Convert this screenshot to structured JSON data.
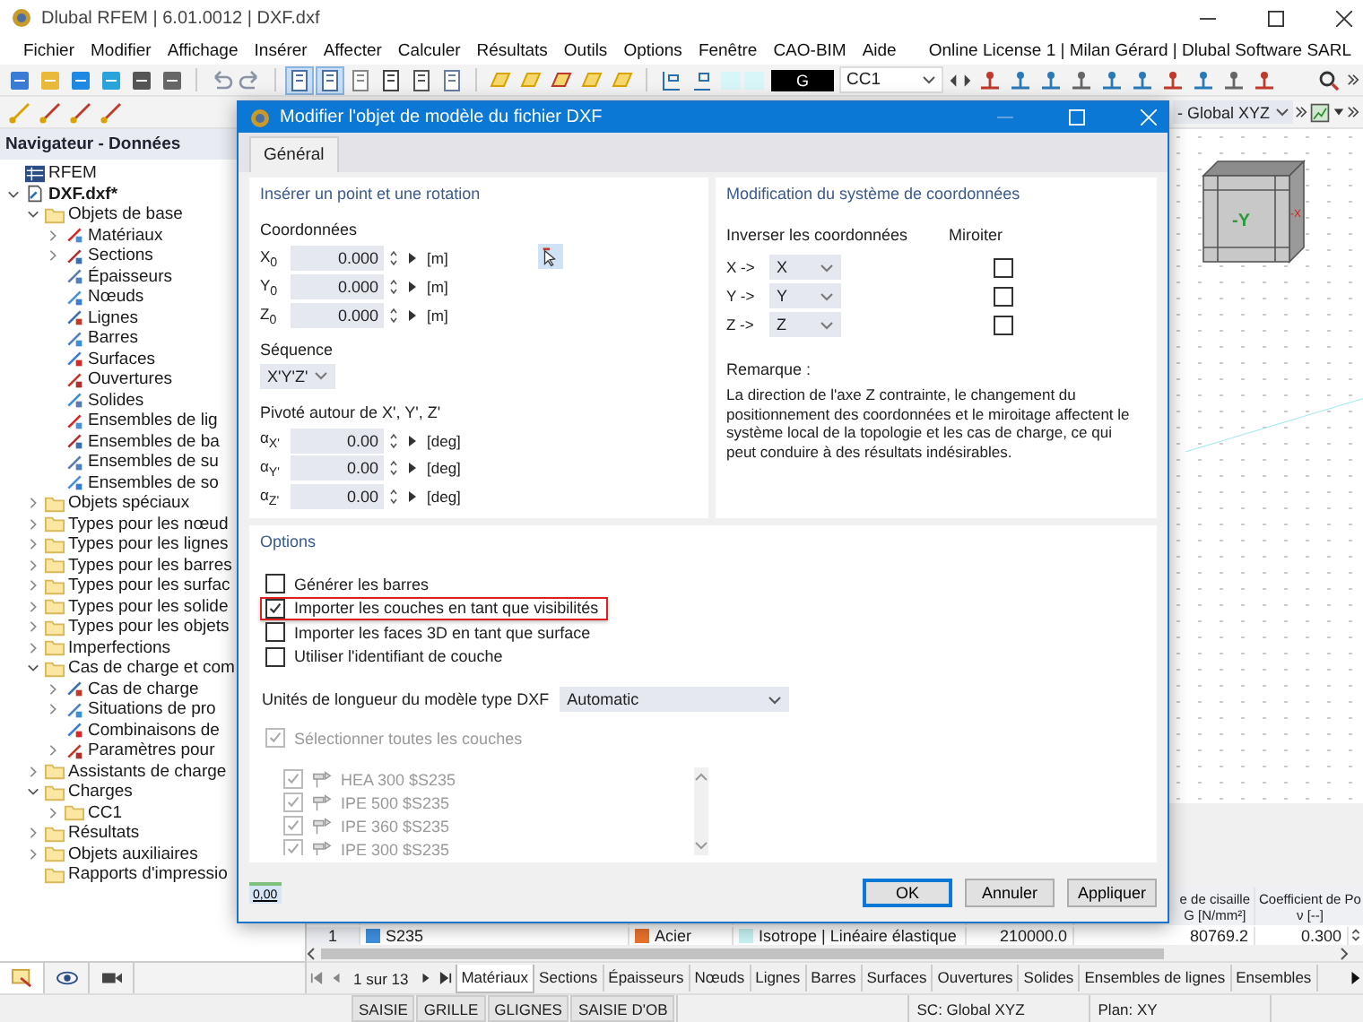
{
  "window": {
    "title": "Dlubal RFEM | 6.01.0012 | DXF.dxf"
  },
  "menu": [
    "Fichier",
    "Modifier",
    "Affichage",
    "Insérer",
    "Affecter",
    "Calculer",
    "Résultats",
    "Outils",
    "Options",
    "Fenêtre",
    "CAO-BIM",
    "Aide"
  ],
  "license": "Online License 1 | Milan Gérard | Dlubal Software SARL",
  "toolbar": {
    "color_label": "G",
    "load_case": "CC1",
    "coord_system": "- Global XYZ"
  },
  "navigator": {
    "title": "Navigateur - Données",
    "tree": [
      {
        "label": "RFEM",
        "kind": "root"
      },
      {
        "label": "DXF.dxf*",
        "kind": "file",
        "expanded": true,
        "children": [
          {
            "label": "Objets de base",
            "kind": "folder",
            "expanded": true,
            "children": [
              {
                "label": "Matériaux",
                "kind": "object",
                "expanded": false
              },
              {
                "label": "Sections",
                "kind": "object",
                "expanded": false
              },
              {
                "label": "Épaisseurs",
                "kind": "object"
              },
              {
                "label": "Nœuds",
                "kind": "object"
              },
              {
                "label": "Lignes",
                "kind": "object"
              },
              {
                "label": "Barres",
                "kind": "object"
              },
              {
                "label": "Surfaces",
                "kind": "object"
              },
              {
                "label": "Ouvertures",
                "kind": "object"
              },
              {
                "label": "Solides",
                "kind": "object"
              },
              {
                "label": "Ensembles de lig",
                "kind": "object"
              },
              {
                "label": "Ensembles de ba",
                "kind": "object"
              },
              {
                "label": "Ensembles de su",
                "kind": "object"
              },
              {
                "label": "Ensembles de so",
                "kind": "object"
              }
            ]
          },
          {
            "label": "Objets spéciaux",
            "kind": "folder",
            "expanded": false
          },
          {
            "label": "Types pour les nœud",
            "kind": "folder",
            "expanded": false
          },
          {
            "label": "Types pour les lignes",
            "kind": "folder",
            "expanded": false
          },
          {
            "label": "Types pour les barres",
            "kind": "folder",
            "expanded": false
          },
          {
            "label": "Types pour les surfac",
            "kind": "folder",
            "expanded": false
          },
          {
            "label": "Types pour les solide",
            "kind": "folder",
            "expanded": false
          },
          {
            "label": "Types pour les objets",
            "kind": "folder",
            "expanded": false
          },
          {
            "label": "Imperfections",
            "kind": "folder",
            "expanded": false
          },
          {
            "label": "Cas de charge et com",
            "kind": "folder",
            "expanded": true,
            "children": [
              {
                "label": "Cas de charge",
                "kind": "object",
                "expanded": false
              },
              {
                "label": "Situations de pro",
                "kind": "object",
                "expanded": false
              },
              {
                "label": "Combinaisons de",
                "kind": "object"
              },
              {
                "label": "Paramètres pour",
                "kind": "object",
                "expanded": false
              }
            ]
          },
          {
            "label": "Assistants de charge",
            "kind": "folder",
            "expanded": false
          },
          {
            "label": "Charges",
            "kind": "folder",
            "expanded": true,
            "children": [
              {
                "label": "CC1",
                "kind": "folder",
                "expanded": false
              }
            ]
          },
          {
            "label": "Résultats",
            "kind": "folder",
            "expanded": false
          },
          {
            "label": "Objets auxiliaires",
            "kind": "folder",
            "expanded": false
          },
          {
            "label": "Rapports d'impressio",
            "kind": "folder"
          }
        ]
      }
    ],
    "tabs": [
      {
        "selected": true
      },
      {
        "selected": false
      },
      {
        "selected": false
      }
    ]
  },
  "view_cube": {
    "labels": [
      "-Y",
      "-X"
    ]
  },
  "table": {
    "headers": [
      {
        "lines": [
          "e de cisaille",
          "G [N/mm²]"
        ]
      },
      {
        "lines": [
          "Coefficient de Po",
          "ν [--]"
        ]
      }
    ],
    "row": [
      {
        "text": "1"
      },
      {
        "text": "S235",
        "color": "#3f8fdf"
      },
      {
        "text": "Acier",
        "color": "#e8732c"
      },
      {
        "text": "Isotrope | Linéaire élastique",
        "color": "#c8f2f2"
      },
      {
        "text": "210000.0"
      },
      {
        "text": "80769.2"
      },
      {
        "text": "0.300"
      }
    ],
    "pager": "1 sur 13",
    "tabs": [
      {
        "label": "Matériaux",
        "selected": true
      },
      {
        "label": "Sections",
        "selected": false
      },
      {
        "label": "Épaisseurs",
        "selected": false
      },
      {
        "label": "Nœuds",
        "selected": false
      },
      {
        "label": "Lignes",
        "selected": false
      },
      {
        "label": "Barres",
        "selected": false
      },
      {
        "label": "Surfaces",
        "selected": false
      },
      {
        "label": "Ouvertures",
        "selected": false
      },
      {
        "label": "Solides",
        "selected": false
      },
      {
        "label": "Ensembles de lignes",
        "selected": false
      },
      {
        "label": "Ensembles",
        "selected": false
      }
    ]
  },
  "status_bar": {
    "toggles": [
      "SAISIE",
      "GRILLE",
      "GLIGNES",
      "SAISIE D'OB"
    ],
    "coord_system": "SC: Global XYZ",
    "plane": "Plan: XY"
  },
  "dialog": {
    "title": "Modifier l'objet de modèle du fichier DXF",
    "tabs": [
      {
        "label": "Général",
        "selected": true
      }
    ],
    "insert": {
      "title": "Insérer un point et une rotation",
      "coords_label": "Coordonnées",
      "coords": [
        {
          "label": "X$_{0}$",
          "value": "0.000",
          "unit": "[m]"
        },
        {
          "label": "Y$_{0}$",
          "value": "0.000",
          "unit": "[m]"
        },
        {
          "label": "Z$_{0}$",
          "value": "0.000",
          "unit": "[m]"
        }
      ],
      "sequence_label": "Séquence",
      "sequence": "X'Y'Z'",
      "rotation_label": "Pivoté autour de X', Y', Z'",
      "rotations": [
        {
          "label": "α$_{X'}$",
          "value": "0.00",
          "unit": "[deg]"
        },
        {
          "label": "α$_{Y'}$",
          "value": "0.00",
          "unit": "[deg]"
        },
        {
          "label": "α$_{Z'}$",
          "value": "0.00",
          "unit": "[deg]"
        }
      ]
    },
    "system": {
      "title": "Modification du système de coordonnées",
      "invert_label": "Inverser les coordonnées",
      "mirror_label": "Miroiter",
      "rows": [
        {
          "label": "X ->",
          "value": "X",
          "mirror": false
        },
        {
          "label": "Y ->",
          "value": "Y",
          "mirror": false
        },
        {
          "label": "Z ->",
          "value": "Z",
          "mirror": false
        }
      ],
      "remark_label": "Remarque :",
      "remark": "La direction de l'axe Z contrainte, le changement du positionnement des coordonnées et le miroitage affectent le système local de la topologie et les cas de charge, ce qui peut conduire à des résultats indésirables."
    },
    "options": {
      "title": "Options",
      "checks": [
        {
          "label": "Générer les barres",
          "checked": false,
          "highlighted": false
        },
        {
          "label": "Importer les couches en tant que visibilités",
          "checked": true,
          "highlighted": true
        },
        {
          "label": "Importer les faces 3D en tant que surface",
          "checked": false,
          "highlighted": false
        },
        {
          "label": "Utiliser l'identifiant de couche",
          "checked": false,
          "highlighted": false
        }
      ],
      "units_label": "Unités de longueur du modèle type DXF",
      "units": "Automatic",
      "select_all": {
        "label": "Sélectionner toutes les couches",
        "checked": true,
        "disabled": true
      },
      "layers": [
        {
          "label": "HEA 300 $S235",
          "checked": true,
          "disabled": true
        },
        {
          "label": "IPE 500 $S235",
          "checked": true,
          "disabled": true
        },
        {
          "label": "IPE 360 $S235",
          "checked": true,
          "disabled": true
        },
        {
          "label": "IPE 300 $S235",
          "checked": true,
          "disabled": true
        }
      ]
    },
    "units_button": "0,00",
    "buttons": [
      {
        "label": "OK",
        "default": true
      },
      {
        "label": "Annuler",
        "default": false
      },
      {
        "label": "Appliquer",
        "default": false
      }
    ]
  }
}
